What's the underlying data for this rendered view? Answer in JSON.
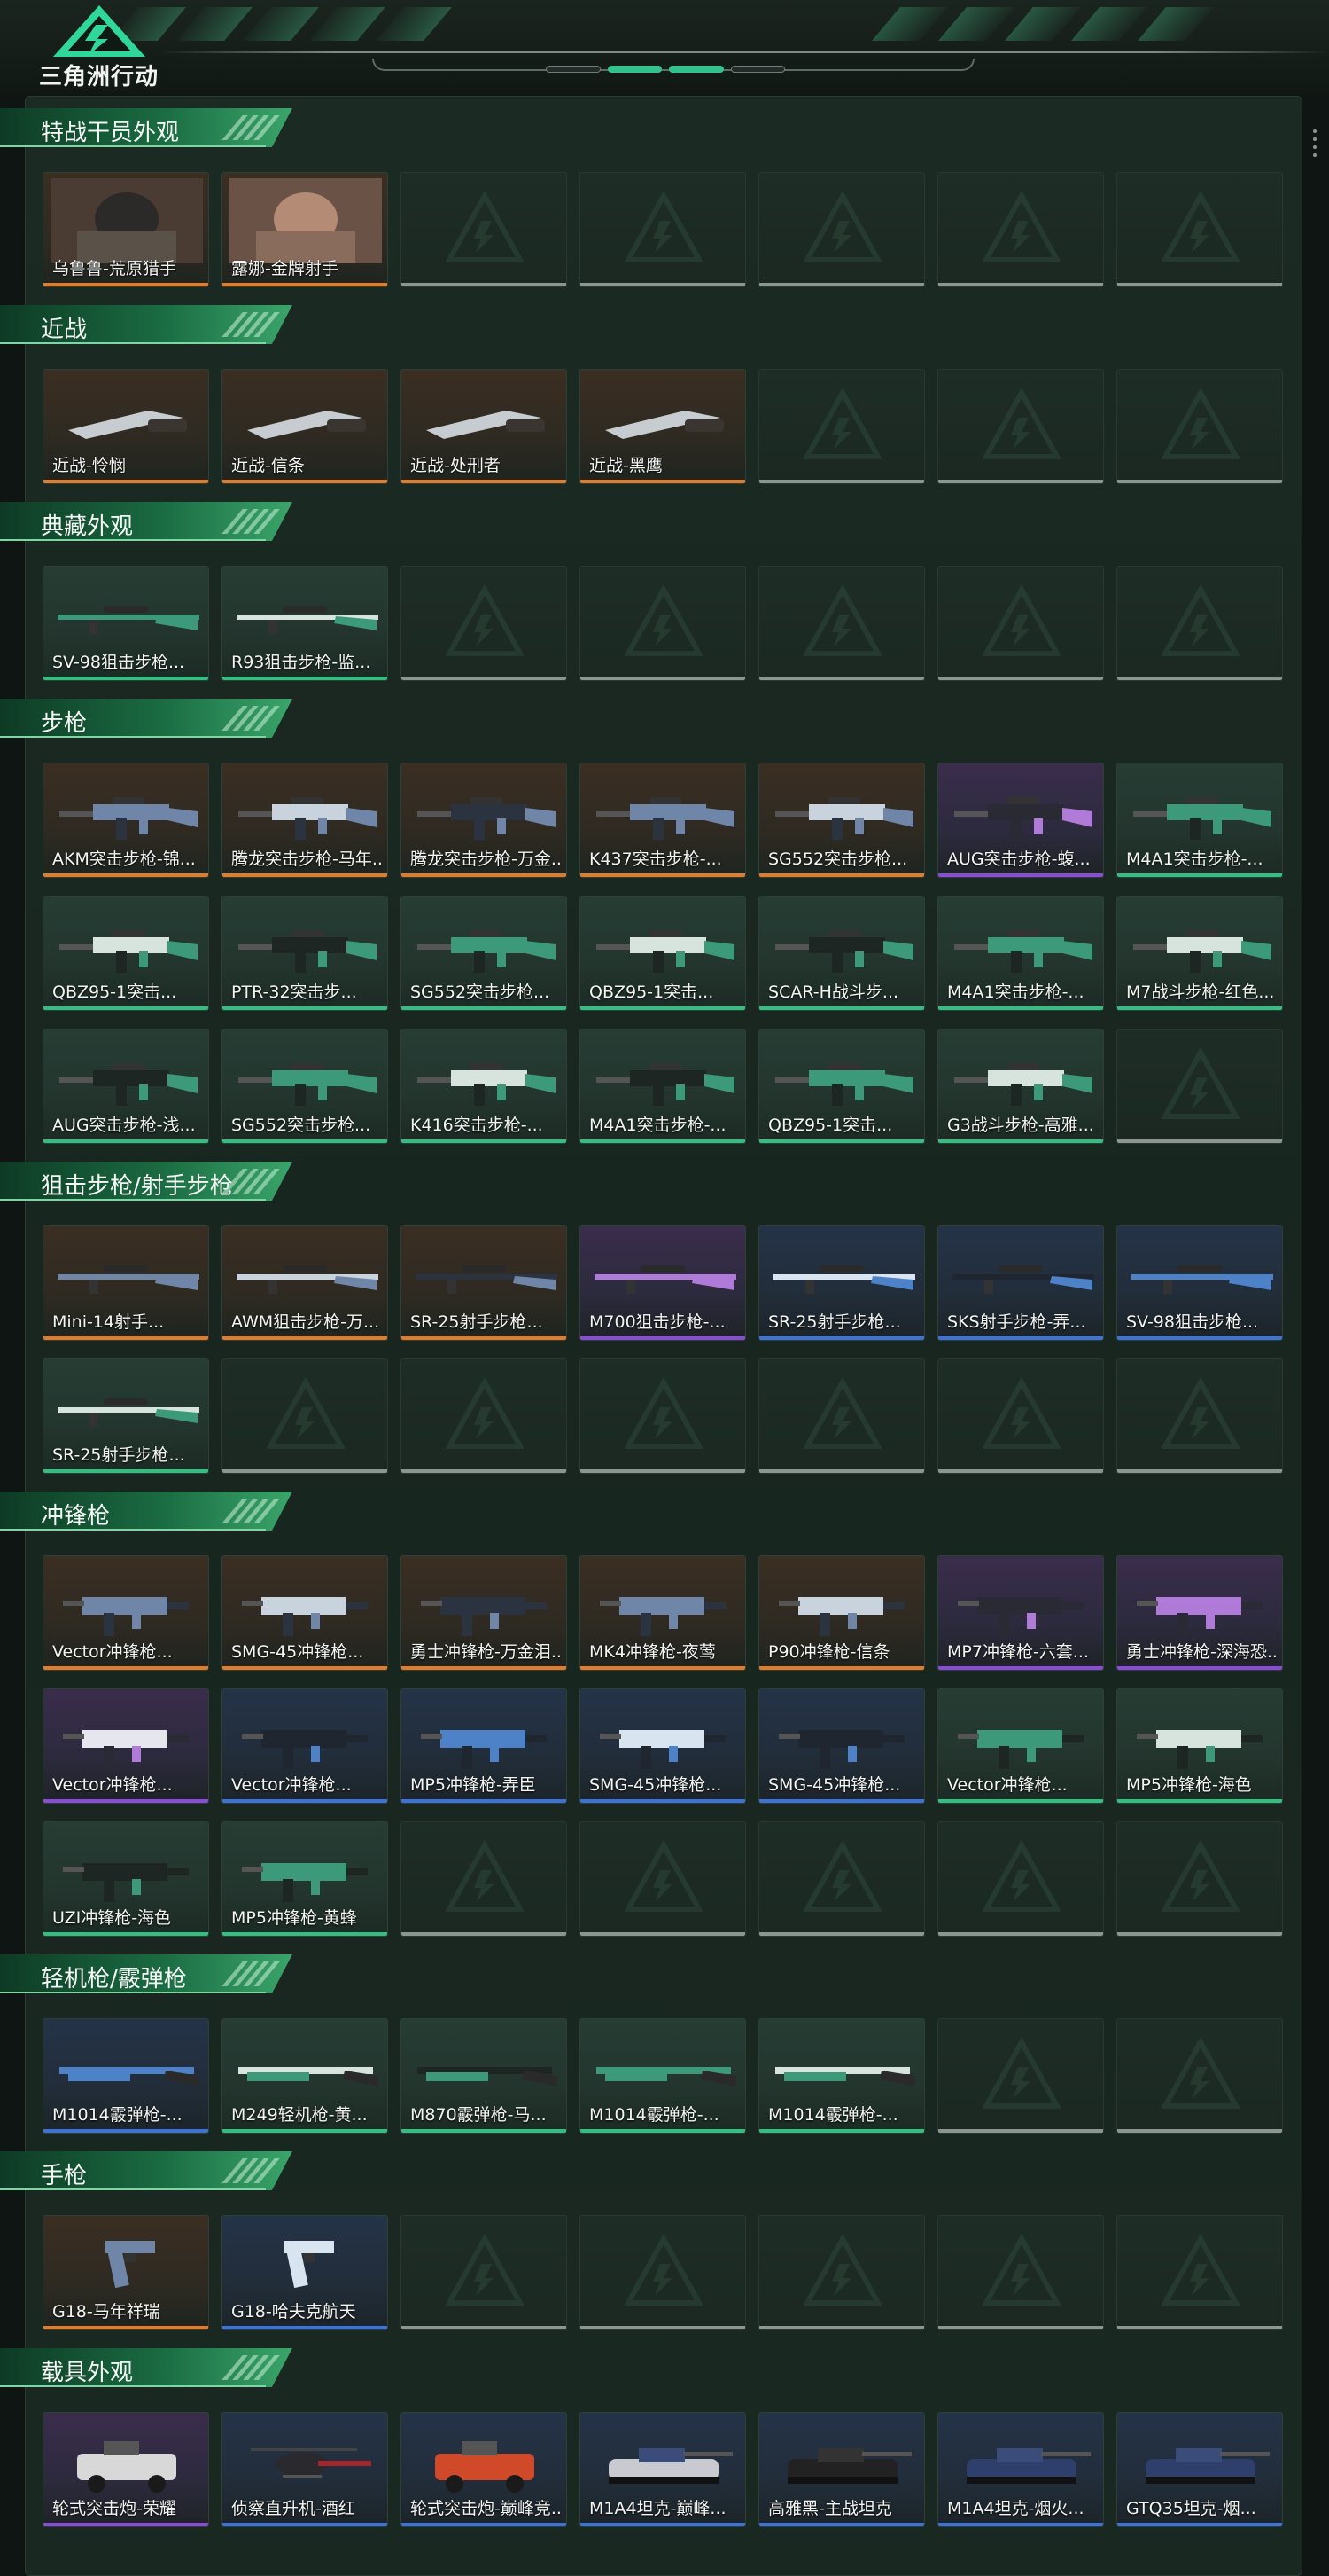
{
  "app": {
    "logo_text": "三角洲行动"
  },
  "pager": {
    "pages": 4,
    "active_index": 1
  },
  "colors": {
    "rarity_orange": "#e07c2a",
    "rarity_purple": "#8a4cd8",
    "rarity_blue": "#3b73d8",
    "rarity_green": "#2fc082",
    "empty_grey": "#8c9690",
    "category_header": "#1a6b42"
  },
  "categories": [
    {
      "title": "特战干员外观",
      "slots": 7,
      "items": [
        {
          "name": "乌鲁鲁-荒原猎手",
          "rarity": "orange",
          "art": "operator"
        },
        {
          "name": "露娜-金牌射手",
          "rarity": "orange",
          "art": "operator2"
        }
      ]
    },
    {
      "title": "近战",
      "slots": 7,
      "items": [
        {
          "name": "近战-怜悯",
          "rarity": "orange",
          "art": "knife"
        },
        {
          "name": "近战-信条",
          "rarity": "orange",
          "art": "knife"
        },
        {
          "name": "近战-处刑者",
          "rarity": "orange",
          "art": "knife"
        },
        {
          "name": "近战-黑鹰",
          "rarity": "orange",
          "art": "knife"
        }
      ]
    },
    {
      "title": "典藏外观",
      "slots": 7,
      "items": [
        {
          "name": "SV-98狙击步枪...",
          "rarity": "green",
          "art": "sniper"
        },
        {
          "name": "R93狙击步枪-监...",
          "rarity": "green",
          "art": "sniper"
        }
      ]
    },
    {
      "title": "步枪",
      "slots": 21,
      "items": [
        {
          "name": "AKM突击步枪-锦...",
          "rarity": "orange",
          "art": "rifle"
        },
        {
          "name": "腾龙突击步枪-马年...",
          "rarity": "orange",
          "art": "rifle"
        },
        {
          "name": "腾龙突击步枪-万金...",
          "rarity": "orange",
          "art": "rifle"
        },
        {
          "name": "K437突击步枪-...",
          "rarity": "orange",
          "art": "rifle"
        },
        {
          "name": "SG552突击步枪...",
          "rarity": "orange",
          "art": "rifle"
        },
        {
          "name": "AUG突击步枪-蝮...",
          "rarity": "purple",
          "art": "rifle"
        },
        {
          "name": "M4A1突击步枪-...",
          "rarity": "green",
          "art": "rifle"
        },
        {
          "name": "QBZ95-1突击...",
          "rarity": "green",
          "art": "rifle"
        },
        {
          "name": "PTR-32突击步...",
          "rarity": "green",
          "art": "rifle"
        },
        {
          "name": "SG552突击步枪...",
          "rarity": "green",
          "art": "rifle"
        },
        {
          "name": "QBZ95-1突击...",
          "rarity": "green",
          "art": "rifle"
        },
        {
          "name": "SCAR-H战斗步...",
          "rarity": "green",
          "art": "rifle"
        },
        {
          "name": "M4A1突击步枪-...",
          "rarity": "green",
          "art": "rifle"
        },
        {
          "name": "M7战斗步枪-红色...",
          "rarity": "green",
          "art": "rifle"
        },
        {
          "name": "AUG突击步枪-浅...",
          "rarity": "green",
          "art": "rifle"
        },
        {
          "name": "SG552突击步枪...",
          "rarity": "green",
          "art": "rifle"
        },
        {
          "name": "K416突击步枪-...",
          "rarity": "green",
          "art": "rifle"
        },
        {
          "name": "M4A1突击步枪-...",
          "rarity": "green",
          "art": "rifle"
        },
        {
          "name": "QBZ95-1突击...",
          "rarity": "green",
          "art": "rifle"
        },
        {
          "name": "G3战斗步枪-高雅...",
          "rarity": "green",
          "art": "rifle"
        }
      ]
    },
    {
      "title": "狙击步枪/射手步枪",
      "slots": 14,
      "items": [
        {
          "name": "Mini-14射手...",
          "rarity": "orange",
          "art": "sniper"
        },
        {
          "name": "AWM狙击步枪-万...",
          "rarity": "orange",
          "art": "sniper"
        },
        {
          "name": "SR-25射手步枪...",
          "rarity": "orange",
          "art": "sniper"
        },
        {
          "name": "M700狙击步枪-...",
          "rarity": "purple",
          "art": "sniper"
        },
        {
          "name": "SR-25射手步枪...",
          "rarity": "blue",
          "art": "sniper"
        },
        {
          "name": "SKS射手步枪-弄...",
          "rarity": "blue",
          "art": "sniper"
        },
        {
          "name": "SV-98狙击步枪...",
          "rarity": "blue",
          "art": "sniper"
        },
        {
          "name": "SR-25射手步枪...",
          "rarity": "green",
          "art": "sniper"
        }
      ]
    },
    {
      "title": "冲锋枪",
      "slots": 21,
      "items": [
        {
          "name": "Vector冲锋枪...",
          "rarity": "orange",
          "art": "smg"
        },
        {
          "name": "SMG-45冲锋枪...",
          "rarity": "orange",
          "art": "smg"
        },
        {
          "name": "勇士冲锋枪-万金泪...",
          "rarity": "orange",
          "art": "smg"
        },
        {
          "name": "MK4冲锋枪-夜莺",
          "rarity": "orange",
          "art": "smg"
        },
        {
          "name": "P90冲锋枪-信条",
          "rarity": "orange",
          "art": "smg"
        },
        {
          "name": "MP7冲锋枪-六套...",
          "rarity": "purple",
          "art": "smg"
        },
        {
          "name": "勇士冲锋枪-深海恐...",
          "rarity": "purple",
          "art": "smg"
        },
        {
          "name": "Vector冲锋枪...",
          "rarity": "purple",
          "art": "smg"
        },
        {
          "name": "Vector冲锋枪...",
          "rarity": "blue",
          "art": "smg"
        },
        {
          "name": "MP5冲锋枪-弄臣",
          "rarity": "blue",
          "art": "smg"
        },
        {
          "name": "SMG-45冲锋枪...",
          "rarity": "blue",
          "art": "smg"
        },
        {
          "name": "SMG-45冲锋枪...",
          "rarity": "blue",
          "art": "smg"
        },
        {
          "name": "Vector冲锋枪...",
          "rarity": "green",
          "art": "smg"
        },
        {
          "name": "MP5冲锋枪-海色",
          "rarity": "green",
          "art": "smg"
        },
        {
          "name": "UZI冲锋枪-海色",
          "rarity": "green",
          "art": "smg"
        },
        {
          "name": "MP5冲锋枪-黄蜂",
          "rarity": "green",
          "art": "smg"
        }
      ]
    },
    {
      "title": "轻机枪/霰弹枪",
      "slots": 7,
      "items": [
        {
          "name": "M1014霰弹枪-...",
          "rarity": "blue",
          "art": "shotgun"
        },
        {
          "name": "M249轻机枪-黄...",
          "rarity": "green",
          "art": "shotgun"
        },
        {
          "name": "M870霰弹枪-马...",
          "rarity": "green",
          "art": "shotgun"
        },
        {
          "name": "M1014霰弹枪-...",
          "rarity": "green",
          "art": "shotgun"
        },
        {
          "name": "M1014霰弹枪-...",
          "rarity": "green",
          "art": "shotgun"
        }
      ]
    },
    {
      "title": "手枪",
      "slots": 7,
      "items": [
        {
          "name": "G18-马年祥瑞",
          "rarity": "orange",
          "art": "pistol"
        },
        {
          "name": "G18-哈夫克航天",
          "rarity": "blue",
          "art": "pistol"
        }
      ]
    },
    {
      "title": "载具外观",
      "slots": 7,
      "items": [
        {
          "name": "轮式突击炮-荣耀",
          "rarity": "purple",
          "art": "vehicle"
        },
        {
          "name": "侦察直升机-酒红",
          "rarity": "blue",
          "art": "heli"
        },
        {
          "name": "轮式突击炮-巅峰竞...",
          "rarity": "blue",
          "art": "vehicle"
        },
        {
          "name": "M1A4坦克-巅峰...",
          "rarity": "blue",
          "art": "tank"
        },
        {
          "name": "高雅黑-主战坦克",
          "rarity": "blue",
          "art": "tank"
        },
        {
          "name": "M1A4坦克-烟火...",
          "rarity": "blue",
          "art": "tank"
        },
        {
          "name": "GTQ35坦克-烟...",
          "rarity": "blue",
          "art": "tank"
        }
      ]
    }
  ]
}
